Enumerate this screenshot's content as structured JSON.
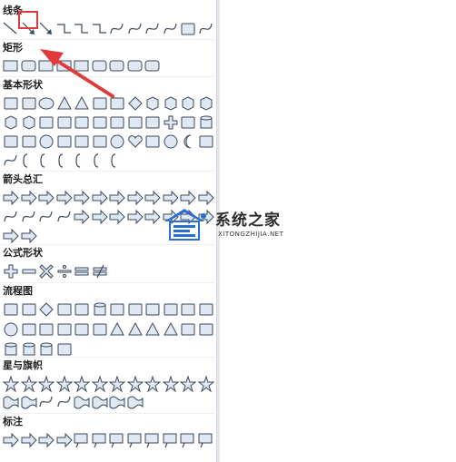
{
  "colors": {
    "stroke": "#3c4a5c",
    "fill": "#dfe8f3",
    "highlight": "#e23a3a",
    "watermark_blue": "#2a6fcf"
  },
  "sections": [
    {
      "key": "lines",
      "title": "线条",
      "rows": [
        [
          "line",
          "arrow-line",
          "double-arrow-line",
          "elbow-connector",
          "elbow-arrow",
          "elbow-double-arrow",
          "curve",
          "curve-arrow",
          "curve-double-arrow",
          "freeform",
          "freeform-shape",
          "scribble"
        ]
      ]
    },
    {
      "key": "rectangles",
      "title": "矩形",
      "rows": [
        [
          "rect",
          "rounded-rect",
          "snip-rect",
          "snip2-rect",
          "snip-diag-rect",
          "snip-round-rect",
          "round1-rect",
          "round2-rect",
          "round-diag-rect"
        ]
      ]
    },
    {
      "key": "basic",
      "title": "基本形状",
      "rows": [
        [
          "text-box",
          "vertical-text-box",
          "oval",
          "triangle",
          "right-triangle",
          "parallelogram",
          "trapezoid",
          "diamond",
          "pentagon",
          "hexagon",
          "heptagon",
          "octagon"
        ],
        [
          "decagon",
          "dodecagon",
          "pie",
          "chord",
          "teardrop",
          "frame",
          "half-frame",
          "l-shape",
          "diagonal-stripe",
          "cross",
          "plaque",
          "can"
        ],
        [
          "cube",
          "bevel",
          "donut",
          "no-symbol",
          "block-arc",
          "folded-corner",
          "smiley",
          "heart",
          "lightning",
          "sun",
          "moon",
          "cloud"
        ],
        [
          "arc",
          "double-bracket",
          "double-brace",
          "left-bracket",
          "right-bracket",
          "left-brace",
          "right-brace"
        ]
      ]
    },
    {
      "key": "arrows",
      "title": "箭头总汇",
      "rows": [
        [
          "right-arrow",
          "left-arrow",
          "up-arrow",
          "down-arrow",
          "left-right-arrow",
          "up-down-arrow",
          "quad-arrow",
          "left-right-up-arrow",
          "bent-arrow",
          "u-turn-arrow",
          "left-up-arrow",
          "bent-up-arrow"
        ],
        [
          "curved-right-arrow",
          "curved-left-arrow",
          "curved-up-arrow",
          "curved-down-arrow",
          "striped-right-arrow",
          "notched-right-arrow",
          "pentagon-arrow",
          "chevron",
          "right-callout",
          "down-callout",
          "left-right-callout",
          "quad-callout"
        ],
        [
          "quad-arrow-callout",
          "circular-arrow"
        ]
      ]
    },
    {
      "key": "equation",
      "title": "公式形状",
      "rows": [
        [
          "plus",
          "minus",
          "multiply",
          "divide",
          "equal",
          "not-equal"
        ]
      ]
    },
    {
      "key": "flowchart",
      "title": "流程图",
      "rows": [
        [
          "process",
          "alternate-process",
          "decision",
          "data",
          "predefined-process",
          "internal-storage",
          "document",
          "multidocument",
          "terminator",
          "preparation",
          "manual-input",
          "manual-operation"
        ],
        [
          "connector",
          "offpage-connector",
          "card",
          "punched-tape",
          "summing-junction",
          "or",
          "collate",
          "sort",
          "extract",
          "merge",
          "stored-data",
          "delay"
        ],
        [
          "sequential-storage",
          "magnetic-disk",
          "direct-access-storage",
          "display"
        ]
      ]
    },
    {
      "key": "stars",
      "title": "星与旗帜",
      "rows": [
        [
          "explosion1",
          "explosion2",
          "star4",
          "star5",
          "star6",
          "star7",
          "star8",
          "star10",
          "star12",
          "star16",
          "star24",
          "star32"
        ],
        [
          "ribbon-up",
          "ribbon-down",
          "curved-ribbon-up",
          "curved-ribbon-down",
          "vertical-scroll",
          "horizontal-scroll",
          "wave",
          "double-wave"
        ]
      ]
    },
    {
      "key": "callouts",
      "title": "标注",
      "rows": [
        [
          "rect-callout",
          "rounded-rect-callout",
          "oval-callout",
          "cloud-callout",
          "line-callout1",
          "line-callout2",
          "line-callout3",
          "line-callout4",
          "accent-callout1",
          "accent-callout2",
          "accent-callout3",
          "accent-callout4"
        ]
      ]
    }
  ],
  "watermark": {
    "title": "系统之家",
    "subtitle": "XITONGZHIJIA.NET"
  }
}
